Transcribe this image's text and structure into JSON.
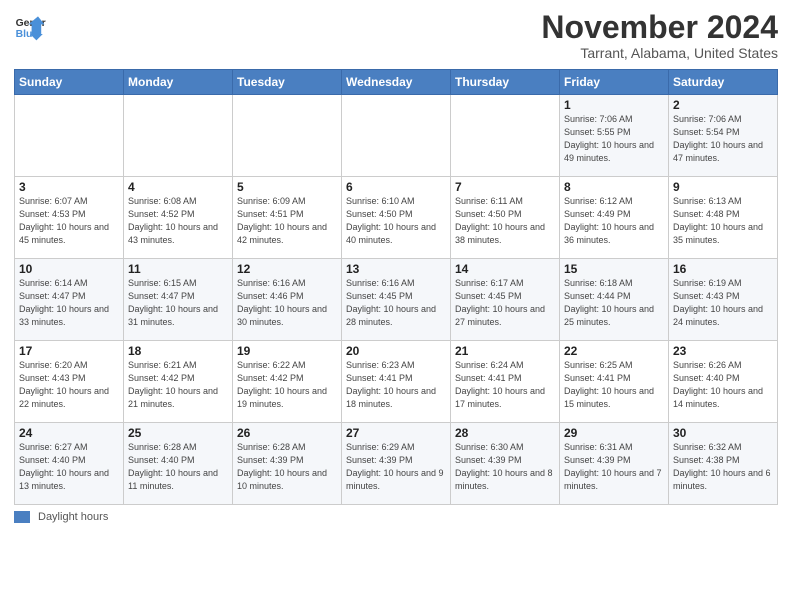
{
  "header": {
    "logo_line1": "General",
    "logo_line2": "Blue",
    "month": "November 2024",
    "location": "Tarrant, Alabama, United States"
  },
  "weekdays": [
    "Sunday",
    "Monday",
    "Tuesday",
    "Wednesday",
    "Thursday",
    "Friday",
    "Saturday"
  ],
  "weeks": [
    [
      {
        "day": "",
        "info": ""
      },
      {
        "day": "",
        "info": ""
      },
      {
        "day": "",
        "info": ""
      },
      {
        "day": "",
        "info": ""
      },
      {
        "day": "",
        "info": ""
      },
      {
        "day": "1",
        "info": "Sunrise: 7:06 AM\nSunset: 5:55 PM\nDaylight: 10 hours\nand 49 minutes."
      },
      {
        "day": "2",
        "info": "Sunrise: 7:06 AM\nSunset: 5:54 PM\nDaylight: 10 hours\nand 47 minutes."
      }
    ],
    [
      {
        "day": "3",
        "info": "Sunrise: 6:07 AM\nSunset: 4:53 PM\nDaylight: 10 hours\nand 45 minutes."
      },
      {
        "day": "4",
        "info": "Sunrise: 6:08 AM\nSunset: 4:52 PM\nDaylight: 10 hours\nand 43 minutes."
      },
      {
        "day": "5",
        "info": "Sunrise: 6:09 AM\nSunset: 4:51 PM\nDaylight: 10 hours\nand 42 minutes."
      },
      {
        "day": "6",
        "info": "Sunrise: 6:10 AM\nSunset: 4:50 PM\nDaylight: 10 hours\nand 40 minutes."
      },
      {
        "day": "7",
        "info": "Sunrise: 6:11 AM\nSunset: 4:50 PM\nDaylight: 10 hours\nand 38 minutes."
      },
      {
        "day": "8",
        "info": "Sunrise: 6:12 AM\nSunset: 4:49 PM\nDaylight: 10 hours\nand 36 minutes."
      },
      {
        "day": "9",
        "info": "Sunrise: 6:13 AM\nSunset: 4:48 PM\nDaylight: 10 hours\nand 35 minutes."
      }
    ],
    [
      {
        "day": "10",
        "info": "Sunrise: 6:14 AM\nSunset: 4:47 PM\nDaylight: 10 hours\nand 33 minutes."
      },
      {
        "day": "11",
        "info": "Sunrise: 6:15 AM\nSunset: 4:47 PM\nDaylight: 10 hours\nand 31 minutes."
      },
      {
        "day": "12",
        "info": "Sunrise: 6:16 AM\nSunset: 4:46 PM\nDaylight: 10 hours\nand 30 minutes."
      },
      {
        "day": "13",
        "info": "Sunrise: 6:16 AM\nSunset: 4:45 PM\nDaylight: 10 hours\nand 28 minutes."
      },
      {
        "day": "14",
        "info": "Sunrise: 6:17 AM\nSunset: 4:45 PM\nDaylight: 10 hours\nand 27 minutes."
      },
      {
        "day": "15",
        "info": "Sunrise: 6:18 AM\nSunset: 4:44 PM\nDaylight: 10 hours\nand 25 minutes."
      },
      {
        "day": "16",
        "info": "Sunrise: 6:19 AM\nSunset: 4:43 PM\nDaylight: 10 hours\nand 24 minutes."
      }
    ],
    [
      {
        "day": "17",
        "info": "Sunrise: 6:20 AM\nSunset: 4:43 PM\nDaylight: 10 hours\nand 22 minutes."
      },
      {
        "day": "18",
        "info": "Sunrise: 6:21 AM\nSunset: 4:42 PM\nDaylight: 10 hours\nand 21 minutes."
      },
      {
        "day": "19",
        "info": "Sunrise: 6:22 AM\nSunset: 4:42 PM\nDaylight: 10 hours\nand 19 minutes."
      },
      {
        "day": "20",
        "info": "Sunrise: 6:23 AM\nSunset: 4:41 PM\nDaylight: 10 hours\nand 18 minutes."
      },
      {
        "day": "21",
        "info": "Sunrise: 6:24 AM\nSunset: 4:41 PM\nDaylight: 10 hours\nand 17 minutes."
      },
      {
        "day": "22",
        "info": "Sunrise: 6:25 AM\nSunset: 4:41 PM\nDaylight: 10 hours\nand 15 minutes."
      },
      {
        "day": "23",
        "info": "Sunrise: 6:26 AM\nSunset: 4:40 PM\nDaylight: 10 hours\nand 14 minutes."
      }
    ],
    [
      {
        "day": "24",
        "info": "Sunrise: 6:27 AM\nSunset: 4:40 PM\nDaylight: 10 hours\nand 13 minutes."
      },
      {
        "day": "25",
        "info": "Sunrise: 6:28 AM\nSunset: 4:40 PM\nDaylight: 10 hours\nand 11 minutes."
      },
      {
        "day": "26",
        "info": "Sunrise: 6:28 AM\nSunset: 4:39 PM\nDaylight: 10 hours\nand 10 minutes."
      },
      {
        "day": "27",
        "info": "Sunrise: 6:29 AM\nSunset: 4:39 PM\nDaylight: 10 hours\nand 9 minutes."
      },
      {
        "day": "28",
        "info": "Sunrise: 6:30 AM\nSunset: 4:39 PM\nDaylight: 10 hours\nand 8 minutes."
      },
      {
        "day": "29",
        "info": "Sunrise: 6:31 AM\nSunset: 4:39 PM\nDaylight: 10 hours\nand 7 minutes."
      },
      {
        "day": "30",
        "info": "Sunrise: 6:32 AM\nSunset: 4:38 PM\nDaylight: 10 hours\nand 6 minutes."
      }
    ]
  ],
  "footer": {
    "legend_label": "Daylight hours"
  }
}
